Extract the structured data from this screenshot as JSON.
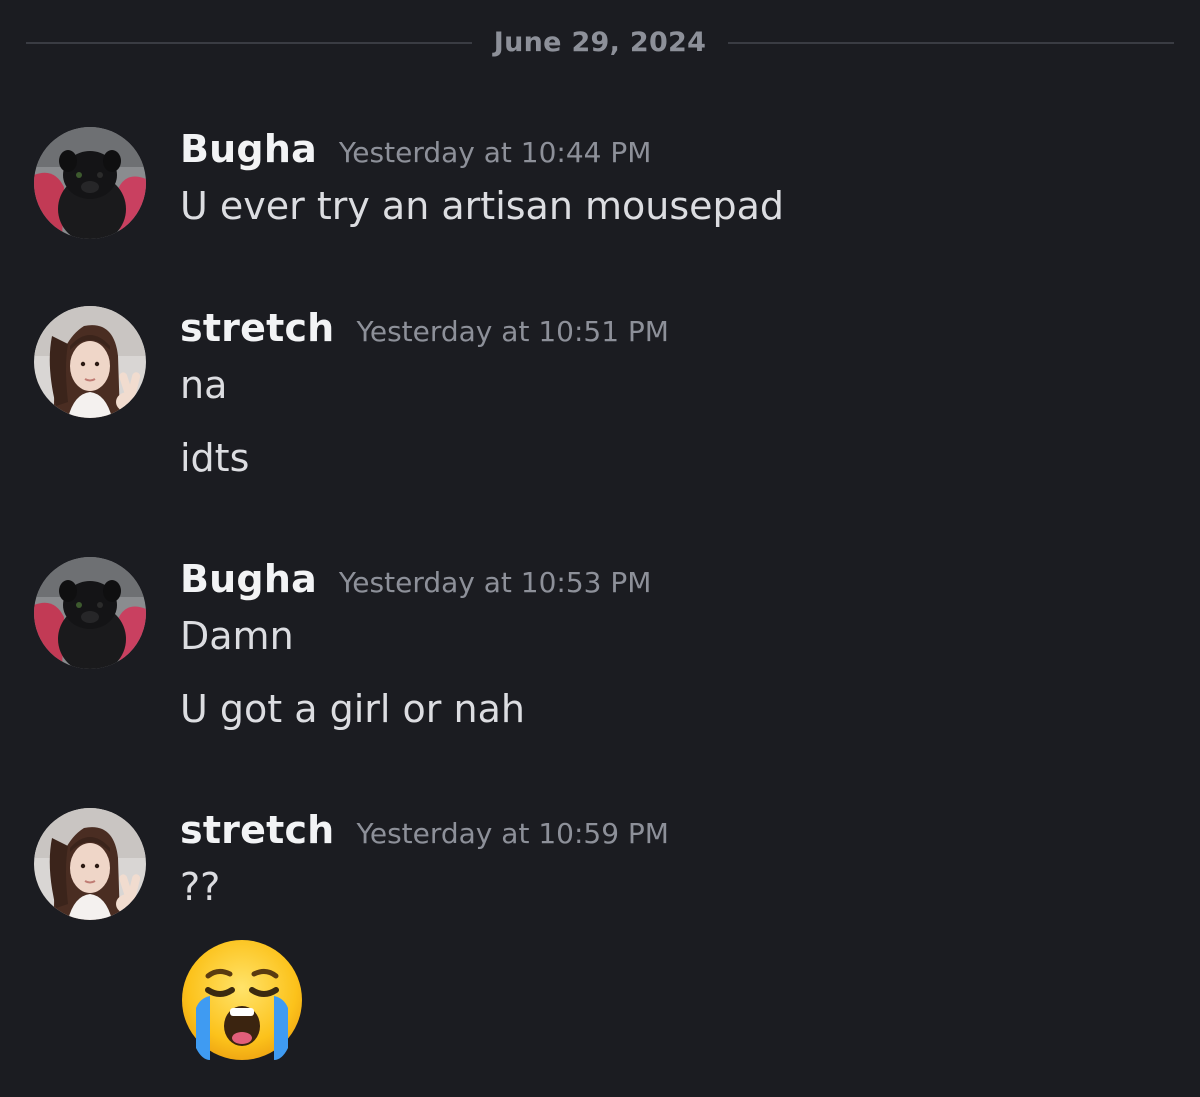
{
  "date_divider": "June 29, 2024",
  "messages": [
    {
      "author": "Bugha",
      "timestamp": "Yesterday at 10:44 PM",
      "lines": [
        "U ever try an artisan mousepad"
      ]
    },
    {
      "author": "stretch",
      "timestamp": "Yesterday at 10:51 PM",
      "lines": [
        "na",
        "idts"
      ]
    },
    {
      "author": "Bugha",
      "timestamp": "Yesterday at 10:53 PM",
      "lines": [
        "Damn",
        "U got a girl or nah"
      ]
    },
    {
      "author": "stretch",
      "timestamp": "Yesterday at 10:59 PM",
      "lines": [
        "??"
      ],
      "emoji": "loudly-crying-face-emoji"
    }
  ],
  "colors": {
    "background": "#1b1c21",
    "username": "#f2f3f5",
    "timestamp": "#8d9099",
    "message_text": "#dcdde1",
    "divider_line": "#3a3c43"
  },
  "icons": {
    "bugha_avatar": "pug-avatar-icon",
    "stretch_avatar": "peace-sign-selfie-avatar-icon"
  }
}
